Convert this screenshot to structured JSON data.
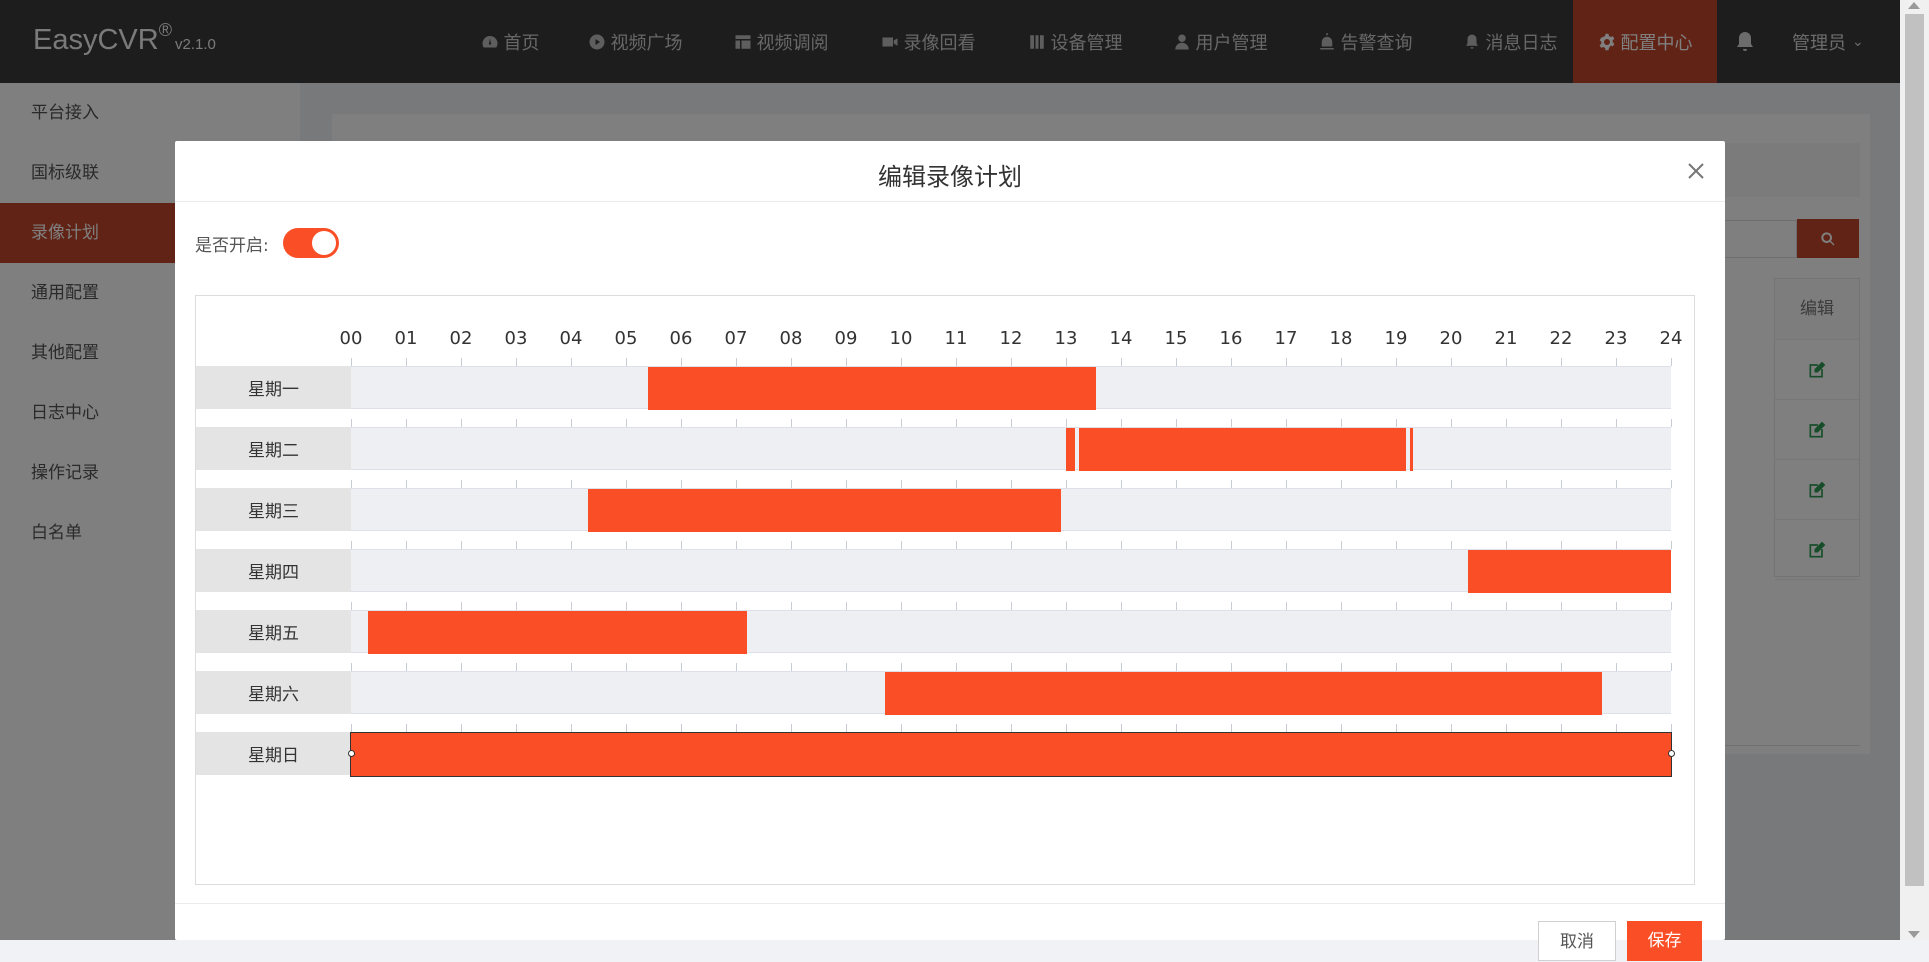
{
  "app": {
    "name": "EasyCVR",
    "reg": "®",
    "version": "v2.1.0"
  },
  "nav": [
    {
      "label": "首页",
      "icon": "dashboard-icon",
      "active": false
    },
    {
      "label": "视频广场",
      "icon": "play-circle-icon",
      "active": false
    },
    {
      "label": "视频调阅",
      "icon": "layout-icon",
      "active": false
    },
    {
      "label": "录像回看",
      "icon": "video-camera-icon",
      "active": false
    },
    {
      "label": "设备管理",
      "icon": "device-icon",
      "active": false
    },
    {
      "label": "用户管理",
      "icon": "user-icon",
      "active": false
    },
    {
      "label": "告警查询",
      "icon": "alarm-icon",
      "active": false
    },
    {
      "label": "消息日志",
      "icon": "bell-small-icon",
      "active": false
    },
    {
      "label": "配置中心",
      "icon": "gear-icon",
      "active": true
    }
  ],
  "user": {
    "name": "管理员"
  },
  "sidebar": {
    "items": [
      {
        "label": "平台接入",
        "active": false
      },
      {
        "label": "国标级联",
        "active": false
      },
      {
        "label": "录像计划",
        "active": true
      },
      {
        "label": "通用配置",
        "active": false
      },
      {
        "label": "其他配置",
        "active": false
      },
      {
        "label": "日志中心",
        "active": false
      },
      {
        "label": "操作记录",
        "active": false
      },
      {
        "label": "白名单",
        "active": false
      }
    ]
  },
  "background_table": {
    "header": "编辑",
    "row_count": 4
  },
  "modal": {
    "title": "编辑录像计划",
    "enabled_label": "是否开启:",
    "enabled": true,
    "cancel_label": "取消",
    "save_label": "保存"
  },
  "schedule": {
    "hours": [
      "00",
      "01",
      "02",
      "03",
      "04",
      "05",
      "06",
      "07",
      "08",
      "09",
      "10",
      "11",
      "12",
      "13",
      "14",
      "15",
      "16",
      "17",
      "18",
      "19",
      "20",
      "21",
      "22",
      "23",
      "24"
    ],
    "days": [
      {
        "label": "星期一",
        "ranges": [
          [
            5.4,
            13.55
          ]
        ]
      },
      {
        "label": "星期二",
        "ranges": [
          [
            13.0,
            13.16
          ],
          [
            13.23,
            19.18
          ],
          [
            19.25,
            19.3
          ]
        ]
      },
      {
        "label": "星期三",
        "ranges": [
          [
            4.3,
            12.9
          ]
        ]
      },
      {
        "label": "星期四",
        "ranges": [
          [
            20.3,
            24.0
          ]
        ]
      },
      {
        "label": "星期五",
        "ranges": [
          [
            0.3,
            7.2
          ]
        ]
      },
      {
        "label": "星期六",
        "ranges": [
          [
            9.7,
            22.75
          ]
        ]
      },
      {
        "label": "星期日",
        "ranges": [
          [
            0.0,
            24.0
          ]
        ],
        "selected": true
      }
    ]
  },
  "colors": {
    "accent": "#fa4f26",
    "nav_active": "#c2462a",
    "topbar": "#3a3a3a",
    "edit_icon": "#2e9d52"
  }
}
